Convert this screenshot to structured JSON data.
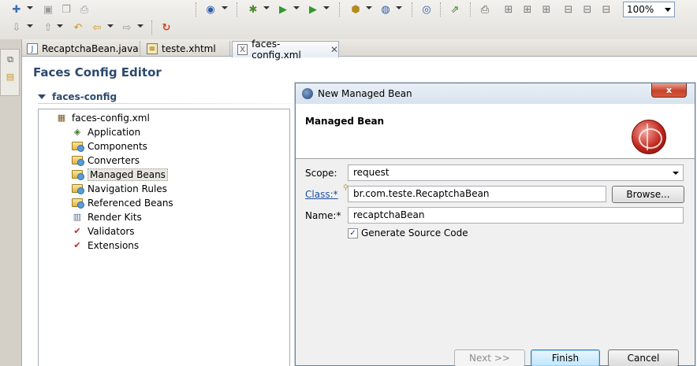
{
  "toolbar": {
    "zoom_value": "100%",
    "icons": [
      "new-icon",
      "save-icon",
      "save-all-icon",
      "print-icon",
      "web-browser-icon",
      "debug-icon",
      "run-icon",
      "run-server-icon",
      "new-class-icon",
      "new-wizard-icon",
      "globe-icon",
      "deploy-icon",
      "printer-icon",
      "layout-icons",
      "back-icon",
      "forward-icon",
      "last-edit-icon",
      "refresh-icon"
    ]
  },
  "tabs": [
    {
      "label": "RecaptchaBean.java",
      "icon": "java-file-icon"
    },
    {
      "label": "teste.xhtml",
      "icon": "html-file-icon"
    },
    {
      "label": "faces-config.xml",
      "icon": "xml-file-icon",
      "active": true
    }
  ],
  "editor": {
    "title": "Faces Config Editor",
    "section": "faces-config",
    "root": "faces-config.xml",
    "nodes": [
      {
        "label": "Application",
        "icon": "application-icon"
      },
      {
        "label": "Components",
        "icon": "folder-icon"
      },
      {
        "label": "Converters",
        "icon": "folder-icon"
      },
      {
        "label": "Managed Beans",
        "icon": "folder-icon",
        "selected": true
      },
      {
        "label": "Navigation Rules",
        "icon": "gear-folder-icon"
      },
      {
        "label": "Referenced Beans",
        "icon": "gear-folder-icon"
      },
      {
        "label": "Render Kits",
        "icon": "render-kit-icon"
      },
      {
        "label": "Validators",
        "icon": "check-icon"
      },
      {
        "label": "Extensions",
        "icon": "check-icon"
      }
    ]
  },
  "dialog": {
    "title": "New Managed Bean",
    "close_label": "x",
    "heading": "Managed Bean",
    "scope_label": "Scope:",
    "scope_value": "request",
    "class_label": "Class:*",
    "class_value": "br.com.teste.RecaptchaBean",
    "browse_label": "Browse...",
    "name_label": "Name:*",
    "name_value": "recaptchaBean",
    "generate_label": "Generate Source Code",
    "generate_checked": true,
    "next_label": "Next >>",
    "finish_label": "Finish",
    "cancel_label": "Cancel"
  }
}
